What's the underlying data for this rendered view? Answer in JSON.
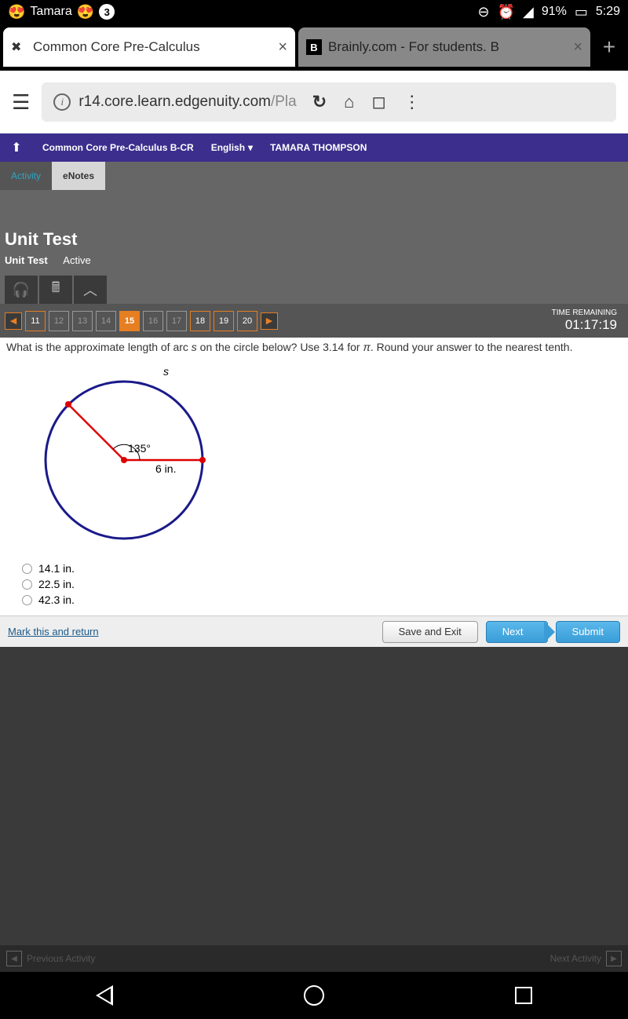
{
  "status": {
    "user": "Tamara",
    "notif_count": "3",
    "battery": "91%",
    "time": "5:29"
  },
  "tabs": {
    "tab1": "Common Core Pre-Calculus",
    "tab2": "Brainly.com - For students. B"
  },
  "url": {
    "domain": "r14.core.learn.edgenuity.com",
    "path": "/Pla"
  },
  "course": {
    "name": "Common Core Pre-Calculus B-CR",
    "lang": "English",
    "student": "TAMARA THOMPSON"
  },
  "subtabs": {
    "activity": "Activity",
    "enotes": "eNotes"
  },
  "test": {
    "title": "Unit Test",
    "subtitle": "Unit Test",
    "status": "Active"
  },
  "nav": {
    "q11": "11",
    "q12": "12",
    "q13": "13",
    "q14": "14",
    "q15": "15",
    "q16": "16",
    "q17": "17",
    "q18": "18",
    "q19": "19",
    "q20": "20"
  },
  "timer": {
    "label": "TIME REMAINING",
    "value": "01:17:19"
  },
  "question": {
    "prefix": "What is the approximate length of arc ",
    "var": "s",
    "mid": " on the circle below? Use 3.14 for ",
    "pi": "π",
    "suffix": ". Round your answer to the nearest tenth."
  },
  "diagram": {
    "arc_label": "s",
    "angle": "135°",
    "radius": "6 in."
  },
  "answers": {
    "a1": "14.1 in.",
    "a2": "22.5 in.",
    "a3": "42.3 in."
  },
  "actions": {
    "mark": "Mark this and return",
    "save": "Save and Exit",
    "next": "Next",
    "submit": "Submit"
  },
  "footer": {
    "prev": "Previous Activity",
    "next": "Next Activity"
  }
}
